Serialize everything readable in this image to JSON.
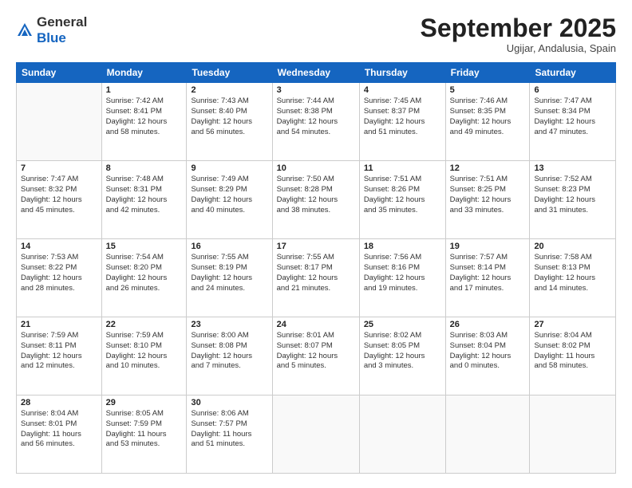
{
  "header": {
    "logo_general": "General",
    "logo_blue": "Blue",
    "month_title": "September 2025",
    "subtitle": "Ugijar, Andalusia, Spain"
  },
  "days_of_week": [
    "Sunday",
    "Monday",
    "Tuesday",
    "Wednesday",
    "Thursday",
    "Friday",
    "Saturday"
  ],
  "weeks": [
    [
      {
        "day": "",
        "info": ""
      },
      {
        "day": "1",
        "info": "Sunrise: 7:42 AM\nSunset: 8:41 PM\nDaylight: 12 hours\nand 58 minutes."
      },
      {
        "day": "2",
        "info": "Sunrise: 7:43 AM\nSunset: 8:40 PM\nDaylight: 12 hours\nand 56 minutes."
      },
      {
        "day": "3",
        "info": "Sunrise: 7:44 AM\nSunset: 8:38 PM\nDaylight: 12 hours\nand 54 minutes."
      },
      {
        "day": "4",
        "info": "Sunrise: 7:45 AM\nSunset: 8:37 PM\nDaylight: 12 hours\nand 51 minutes."
      },
      {
        "day": "5",
        "info": "Sunrise: 7:46 AM\nSunset: 8:35 PM\nDaylight: 12 hours\nand 49 minutes."
      },
      {
        "day": "6",
        "info": "Sunrise: 7:47 AM\nSunset: 8:34 PM\nDaylight: 12 hours\nand 47 minutes."
      }
    ],
    [
      {
        "day": "7",
        "info": "Sunrise: 7:47 AM\nSunset: 8:32 PM\nDaylight: 12 hours\nand 45 minutes."
      },
      {
        "day": "8",
        "info": "Sunrise: 7:48 AM\nSunset: 8:31 PM\nDaylight: 12 hours\nand 42 minutes."
      },
      {
        "day": "9",
        "info": "Sunrise: 7:49 AM\nSunset: 8:29 PM\nDaylight: 12 hours\nand 40 minutes."
      },
      {
        "day": "10",
        "info": "Sunrise: 7:50 AM\nSunset: 8:28 PM\nDaylight: 12 hours\nand 38 minutes."
      },
      {
        "day": "11",
        "info": "Sunrise: 7:51 AM\nSunset: 8:26 PM\nDaylight: 12 hours\nand 35 minutes."
      },
      {
        "day": "12",
        "info": "Sunrise: 7:51 AM\nSunset: 8:25 PM\nDaylight: 12 hours\nand 33 minutes."
      },
      {
        "day": "13",
        "info": "Sunrise: 7:52 AM\nSunset: 8:23 PM\nDaylight: 12 hours\nand 31 minutes."
      }
    ],
    [
      {
        "day": "14",
        "info": "Sunrise: 7:53 AM\nSunset: 8:22 PM\nDaylight: 12 hours\nand 28 minutes."
      },
      {
        "day": "15",
        "info": "Sunrise: 7:54 AM\nSunset: 8:20 PM\nDaylight: 12 hours\nand 26 minutes."
      },
      {
        "day": "16",
        "info": "Sunrise: 7:55 AM\nSunset: 8:19 PM\nDaylight: 12 hours\nand 24 minutes."
      },
      {
        "day": "17",
        "info": "Sunrise: 7:55 AM\nSunset: 8:17 PM\nDaylight: 12 hours\nand 21 minutes."
      },
      {
        "day": "18",
        "info": "Sunrise: 7:56 AM\nSunset: 8:16 PM\nDaylight: 12 hours\nand 19 minutes."
      },
      {
        "day": "19",
        "info": "Sunrise: 7:57 AM\nSunset: 8:14 PM\nDaylight: 12 hours\nand 17 minutes."
      },
      {
        "day": "20",
        "info": "Sunrise: 7:58 AM\nSunset: 8:13 PM\nDaylight: 12 hours\nand 14 minutes."
      }
    ],
    [
      {
        "day": "21",
        "info": "Sunrise: 7:59 AM\nSunset: 8:11 PM\nDaylight: 12 hours\nand 12 minutes."
      },
      {
        "day": "22",
        "info": "Sunrise: 7:59 AM\nSunset: 8:10 PM\nDaylight: 12 hours\nand 10 minutes."
      },
      {
        "day": "23",
        "info": "Sunrise: 8:00 AM\nSunset: 8:08 PM\nDaylight: 12 hours\nand 7 minutes."
      },
      {
        "day": "24",
        "info": "Sunrise: 8:01 AM\nSunset: 8:07 PM\nDaylight: 12 hours\nand 5 minutes."
      },
      {
        "day": "25",
        "info": "Sunrise: 8:02 AM\nSunset: 8:05 PM\nDaylight: 12 hours\nand 3 minutes."
      },
      {
        "day": "26",
        "info": "Sunrise: 8:03 AM\nSunset: 8:04 PM\nDaylight: 12 hours\nand 0 minutes."
      },
      {
        "day": "27",
        "info": "Sunrise: 8:04 AM\nSunset: 8:02 PM\nDaylight: 11 hours\nand 58 minutes."
      }
    ],
    [
      {
        "day": "28",
        "info": "Sunrise: 8:04 AM\nSunset: 8:01 PM\nDaylight: 11 hours\nand 56 minutes."
      },
      {
        "day": "29",
        "info": "Sunrise: 8:05 AM\nSunset: 7:59 PM\nDaylight: 11 hours\nand 53 minutes."
      },
      {
        "day": "30",
        "info": "Sunrise: 8:06 AM\nSunset: 7:57 PM\nDaylight: 11 hours\nand 51 minutes."
      },
      {
        "day": "",
        "info": ""
      },
      {
        "day": "",
        "info": ""
      },
      {
        "day": "",
        "info": ""
      },
      {
        "day": "",
        "info": ""
      }
    ]
  ]
}
